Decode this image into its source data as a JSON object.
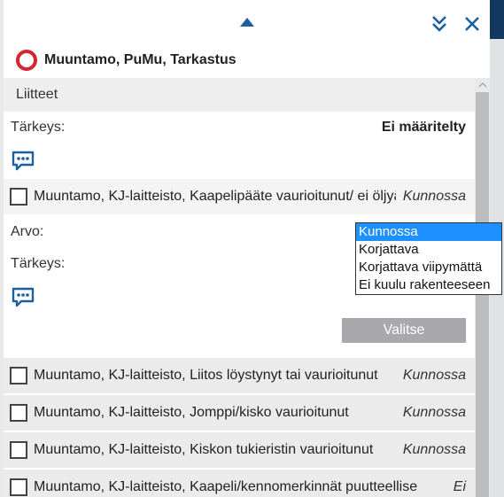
{
  "header": {
    "title": "Muuntamo, PuMu, Tarkastus",
    "status_color": "#d4262f"
  },
  "section": {
    "label": "Liitteet"
  },
  "priority_row": {
    "label": "Tärkeys:",
    "value": "Ei määritelty"
  },
  "expanded_item": {
    "label": "Muuntamo, KJ-laitteisto, Kaapelipääte vaurioitunut/ ei öljyä",
    "status": "Kunnossa",
    "value_label": "Arvo:",
    "priority_label": "Tärkeys:",
    "select_button": "Valitse"
  },
  "dropdown": {
    "options": [
      "Kunnossa",
      "Korjattava",
      "Korjattava viipymättä",
      "Ei kuulu rakenteeseen"
    ],
    "selected": "Kunnossa",
    "highlight_color": "#1e90ff"
  },
  "items": [
    {
      "label": "Muuntamo, KJ-laitteisto, Liitos löystynyt tai vaurioitunut",
      "status": "Kunnossa"
    },
    {
      "label": "Muuntamo, KJ-laitteisto, Jomppi/kisko vaurioitunut",
      "status": "Kunnossa"
    },
    {
      "label": "Muuntamo, KJ-laitteisto, Kiskon tukieristin vaurioitunut",
      "status": "Kunnossa"
    },
    {
      "label": "Muuntamo, KJ-laitteisto, Kaapeli/kennomerkinnät puutteellise",
      "status": "Ei"
    }
  ],
  "icons": {
    "collapse": "caret-up-icon",
    "minimize": "double-chevron-down-icon",
    "close": "close-icon",
    "comment": "comment-icon",
    "accent": "#1f5f9e"
  }
}
